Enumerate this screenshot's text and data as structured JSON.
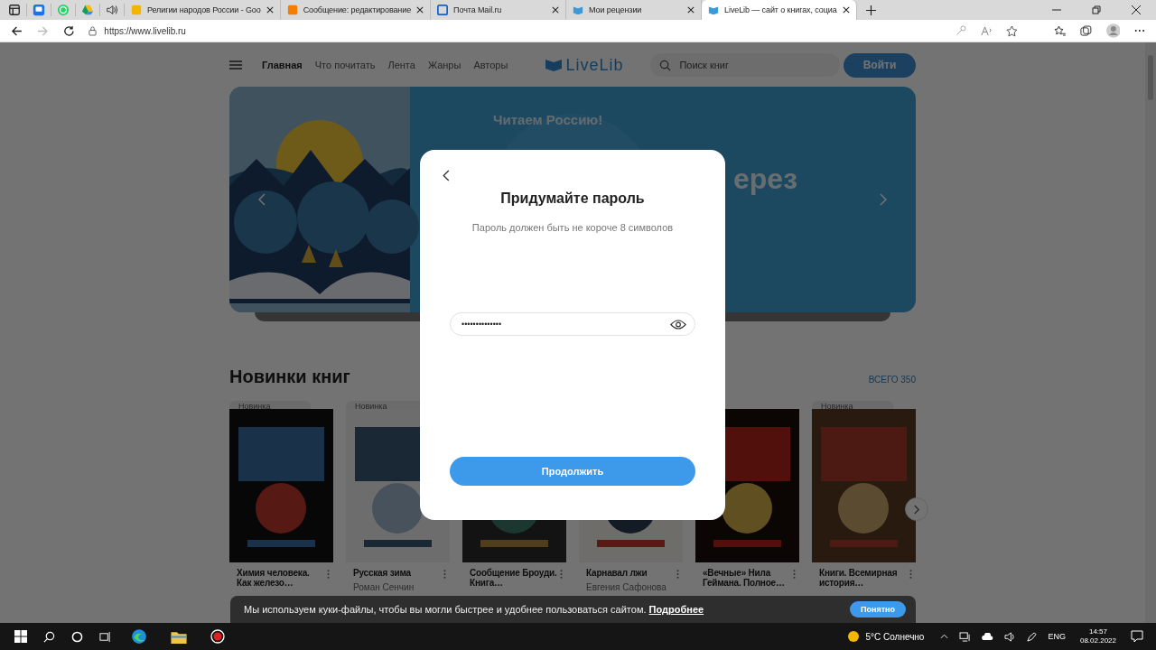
{
  "tabs": [
    {
      "title": "Религии народов России - Goo",
      "kind": "slides",
      "selected": false
    },
    {
      "title": "Сообщение: редактирование",
      "kind": "blogger",
      "selected": false
    },
    {
      "title": "Почта Mail.ru",
      "kind": "mail",
      "selected": false
    },
    {
      "title": "Мои рецензии",
      "kind": "livelib",
      "selected": false
    },
    {
      "title": "LiveLib — сайт о книгах, социа",
      "kind": "livelib",
      "selected": true
    }
  ],
  "address": "https://www.livelib.ru",
  "site": {
    "nav": [
      {
        "label": "Главная",
        "selected": true
      },
      {
        "label": "Что почитать",
        "selected": false
      },
      {
        "label": "Лента",
        "selected": false
      },
      {
        "label": "Жанры",
        "selected": false
      },
      {
        "label": "Авторы",
        "selected": false
      }
    ],
    "logo": "LiveLib",
    "search_placeholder": "Поиск книг",
    "login": "Войти"
  },
  "banner": {
    "title": "Читаем Россию!",
    "heading_fragment": "ерез"
  },
  "section": {
    "title": "Новинки книг",
    "total": "ВСЕГО 350"
  },
  "books": [
    {
      "badge": "Новинка",
      "title": "Химия человека. Как железо…"
    },
    {
      "badge": "Новинка",
      "title": "Русская зима",
      "author": "Роман Сенчин"
    },
    {
      "title": "Сообщение Броуди. Книга…"
    },
    {
      "title": "Карнавал лжи",
      "author": "Евгения Сафонова"
    },
    {
      "title": "«Вечные» Нила Геймана. Полное…"
    },
    {
      "badge": "Новинка",
      "title": "Книги. Всемирная история…"
    }
  ],
  "modal": {
    "title": "Придумайте пароль",
    "hint": "Пароль должен быть не короче 8 символов",
    "password": "••••••••••••••",
    "button": "Продолжить"
  },
  "cookie": {
    "text": "Мы используем куки-файлы, чтобы вы могли быстрее и удобнее пользоваться сайтом.",
    "link": "Подробнее",
    "button": "Понятно"
  },
  "taskbar": {
    "weather": "5°C Солнечно",
    "lang": "ENG",
    "time": "14:57",
    "date": "08.02.2022"
  }
}
